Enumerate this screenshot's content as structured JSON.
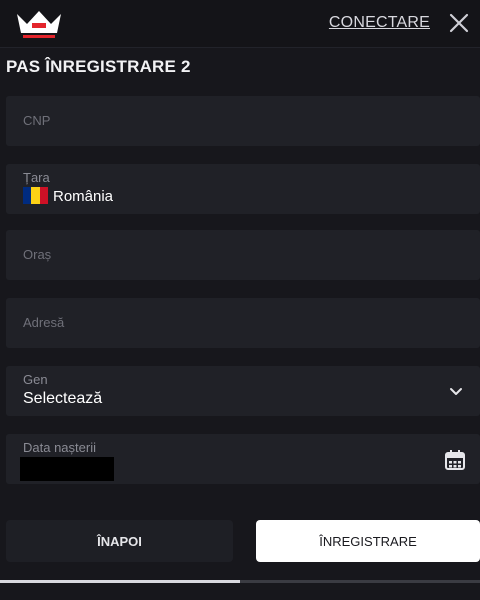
{
  "header": {
    "login_label": "CONECTARE",
    "logo_icon": "crown-logo-icon",
    "close_icon": "close-icon"
  },
  "page": {
    "step_title": "PAS ÎNREGISTRARE 2"
  },
  "form": {
    "cnp": {
      "placeholder": "CNP",
      "value": ""
    },
    "country": {
      "label": "Țara",
      "value": "România",
      "flag_colors": [
        "#002B7F",
        "#FCD116",
        "#CE1126"
      ]
    },
    "city": {
      "placeholder": "Oraș",
      "value": ""
    },
    "address": {
      "placeholder": "Adresă",
      "value": ""
    },
    "gender": {
      "label": "Gen",
      "value": "Selectează",
      "icon": "chevron-down-icon"
    },
    "birthdate": {
      "label": "Data nașterii",
      "value_redacted": true,
      "icon": "calendar-icon"
    }
  },
  "footer": {
    "back_label": "ÎNAPOI",
    "register_label": "ÎNREGISTRARE",
    "progress": 0.5
  },
  "colors": {
    "background": "#17171c",
    "field_background": "#202127",
    "primary_button": "#ffffff"
  }
}
